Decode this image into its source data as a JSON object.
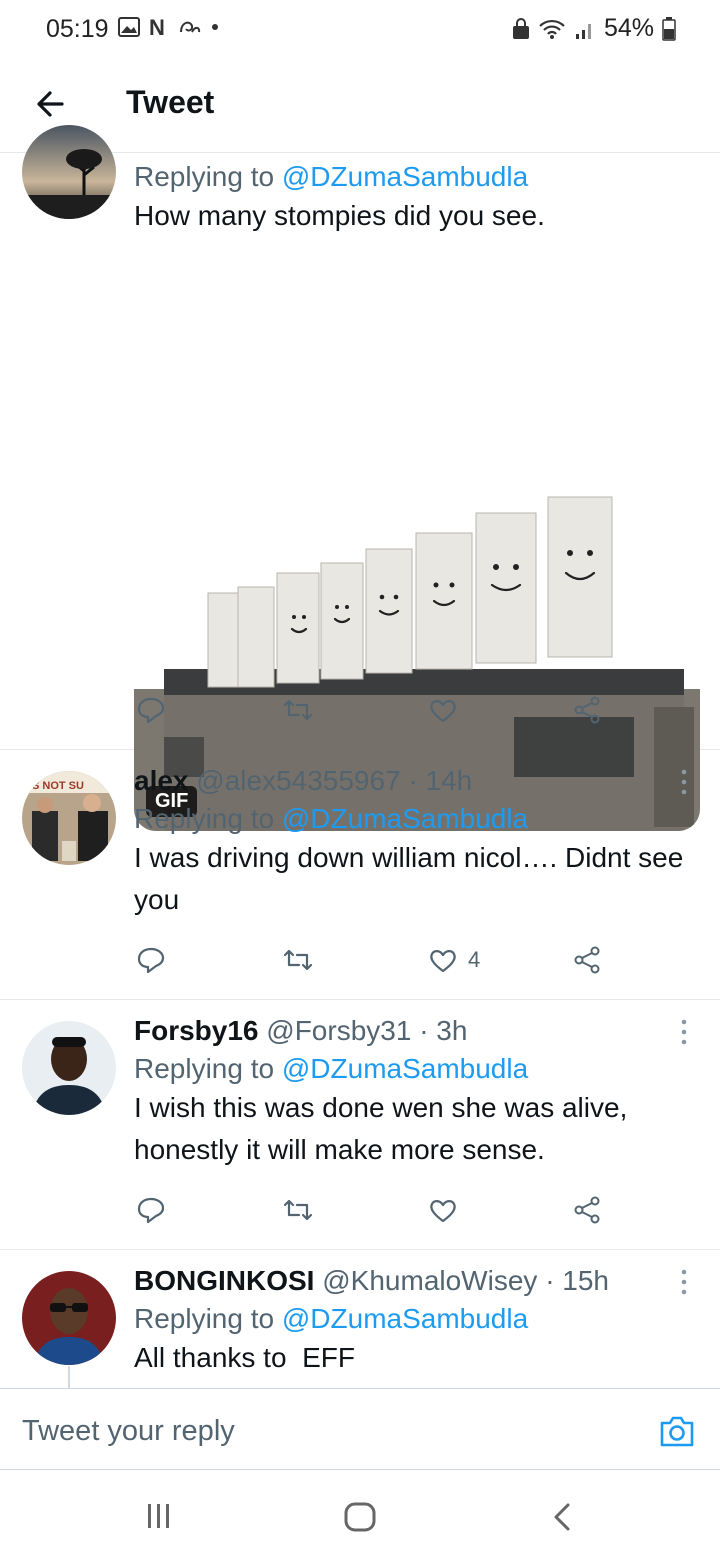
{
  "status": {
    "time": "05:19",
    "battery": "54%"
  },
  "header": {
    "title": "Tweet"
  },
  "tweets": [
    {
      "replying_prefix": "Replying to",
      "replying_handle": "@DZumaSambudla",
      "text": "How many stompies did you see.",
      "media_badge": "GIF"
    },
    {
      "name": "alex",
      "handle": "@alex54355967",
      "time": "· 14h",
      "replying_prefix": "Replying to",
      "replying_handle": "@DZumaSambudla",
      "text": "I was driving down william nicol…. Didnt see you",
      "likes": "4"
    },
    {
      "name": "Forsby16",
      "handle": "@Forsby31",
      "time": "· 3h",
      "replying_prefix": "Replying to",
      "replying_handle": "@DZumaSambudla",
      "text": "I wish this was done wen she was alive, honestly it will make more sense."
    },
    {
      "name": "BONGINKOSI",
      "handle": "@KhumaloWisey",
      "time": "· 15h",
      "replying_prefix": "Replying to",
      "replying_handle": "@DZumaSambudla",
      "text": "All thanks to  EFF"
    }
  ],
  "reply_box": {
    "placeholder": "Tweet your reply"
  },
  "colors": {
    "accent": "#1d9bf0",
    "secondary_text": "#536471",
    "divider": "#e6e9eb"
  }
}
